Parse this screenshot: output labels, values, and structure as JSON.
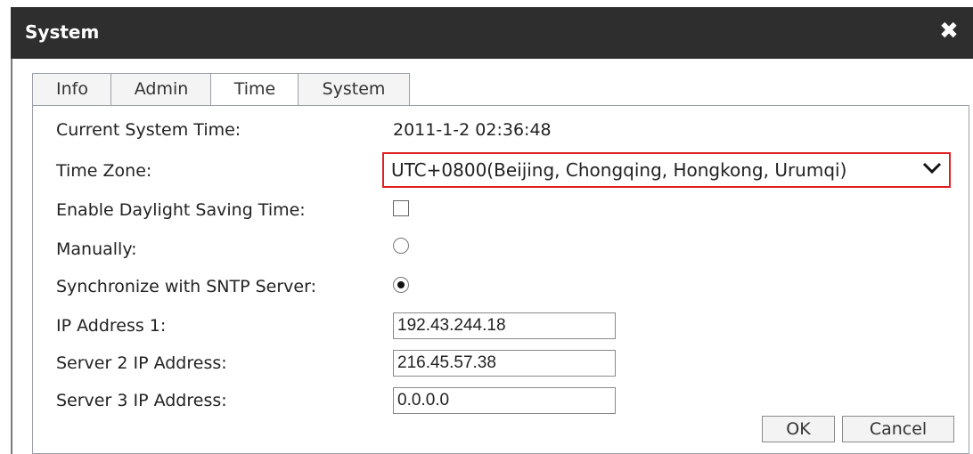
{
  "dialog": {
    "title": "System",
    "close_glyph": "✖"
  },
  "tabs": [
    {
      "label": "Info",
      "active": false
    },
    {
      "label": "Admin",
      "active": false
    },
    {
      "label": "Time",
      "active": true
    },
    {
      "label": "System",
      "active": false
    }
  ],
  "time": {
    "current_time_label": "Current System Time:",
    "current_time_value": "2011-1-2 02:36:48",
    "time_zone_label": "Time Zone:",
    "time_zone_value": "UTC+0800(Beijing, Chongqing, Hongkong, Urumqi)",
    "dst_label": "Enable Daylight Saving Time:",
    "dst_checked": false,
    "manual_label": "Manually:",
    "manual_selected": false,
    "sntp_label": "Synchronize with SNTP Server:",
    "sntp_selected": true,
    "ip1_label": "IP Address 1:",
    "ip1_value": "192.43.244.18",
    "ip2_label": "Server 2 IP Address:",
    "ip2_value": "216.45.57.38",
    "ip3_label": "Server 3 IP Address:",
    "ip3_value": "0.0.0.0"
  },
  "buttons": {
    "ok": "OK",
    "cancel": "Cancel"
  },
  "colors": {
    "titlebar": "#2e2e2e",
    "highlight": "#e02020",
    "border": "#9aa0a8"
  }
}
